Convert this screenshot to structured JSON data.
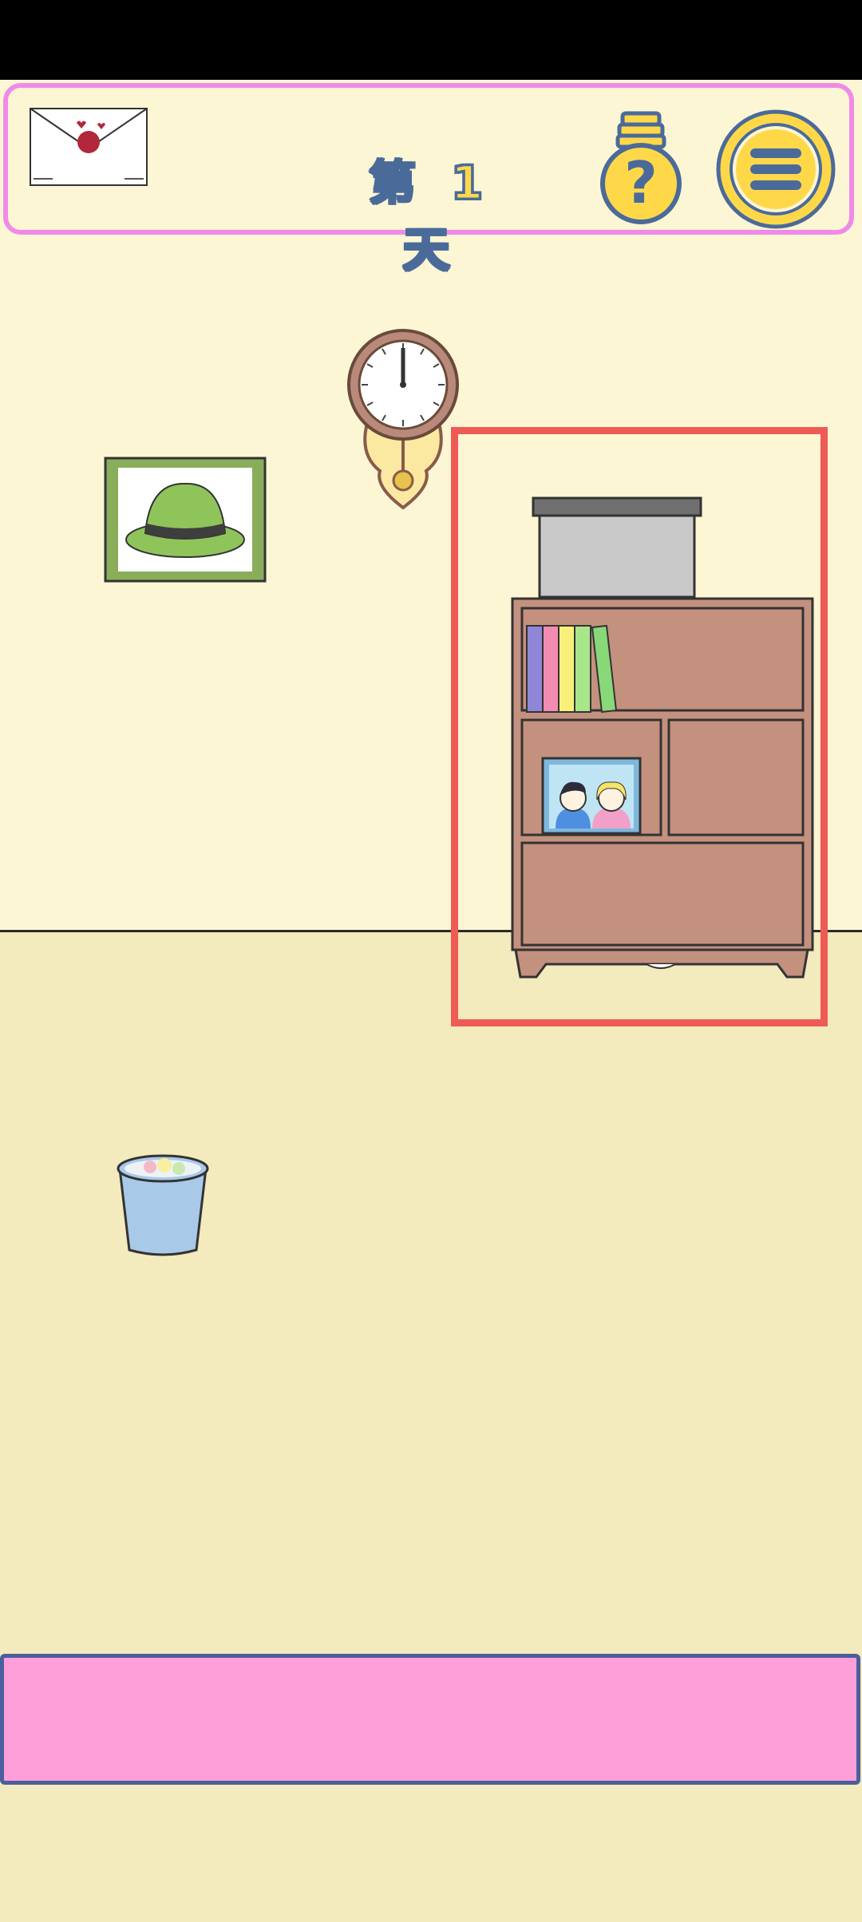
{
  "header": {
    "day_label": "第 1 天",
    "letter_icon": "envelope-icon",
    "hint_icon": "lightbulb-question-icon",
    "menu_icon": "hamburger-menu-icon"
  },
  "scene": {
    "objects": [
      "wall-clock",
      "hat-painting",
      "storage-box",
      "bookshelf",
      "couple-photo",
      "books",
      "trash-can"
    ],
    "highlight_color": "#ef5a54"
  },
  "inventory": {
    "items": []
  },
  "colors": {
    "wall": "#fcf6d4",
    "floor": "#f3eabd",
    "top_bar_border": "#f08ae8",
    "inventory_bar": "#ff9fda",
    "shelf": "#c4917f"
  }
}
